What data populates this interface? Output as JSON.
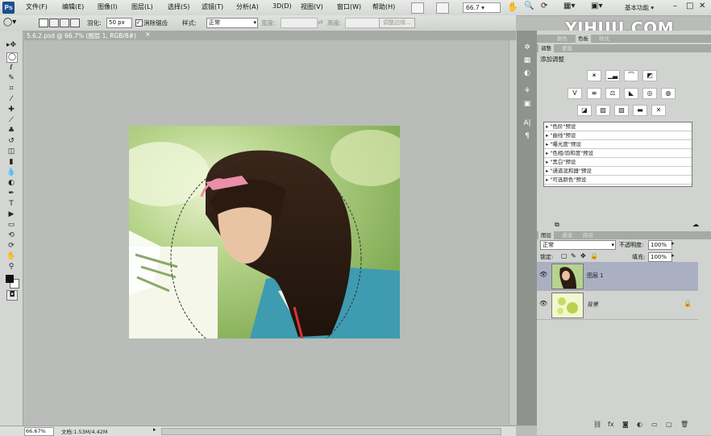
{
  "menubar": {
    "logo": "Ps",
    "items": [
      "文件(F)",
      "编辑(E)",
      "图像(I)",
      "图层(L)",
      "选择(S)",
      "滤镜(T)",
      "分析(A)",
      "3D(D)",
      "视图(V)",
      "窗口(W)",
      "帮助(H)"
    ],
    "zoom": "66.7",
    "workspace": "基本功能",
    "brand": "YIHUU.COM"
  },
  "options": {
    "feather_label": "羽化:",
    "feather_value": "50 px",
    "antialias_label": "消除锯齿",
    "style_label": "样式:",
    "style_value": "正常",
    "width_label": "宽度:",
    "height_label": "高度:",
    "refine_button": "调整边缘..."
  },
  "document": {
    "tab_title": "5.6.2.psd @ 66.7% (图层 1, RGB/8#)"
  },
  "status": {
    "zoom": "66.67%",
    "doc_info": "文档:1.53M/4.42M"
  },
  "adjust_panel": {
    "tabs": [
      "调整",
      "蒙版"
    ],
    "top_tabs": [
      "颜色",
      "色板",
      "样式"
    ],
    "heading": "添加调整",
    "presets": [
      "\"色阶\"预设",
      "\"曲线\"预设",
      "\"曝光度\"预设",
      "\"色相/饱和度\"预设",
      "\"黑白\"预设",
      "\"通道混和器\"预设",
      "\"可选颜色\"预设"
    ]
  },
  "layers_panel": {
    "tabs": [
      "图层",
      "通道",
      "路径"
    ],
    "blend_mode": "正常",
    "opacity_label": "不透明度:",
    "opacity": "100%",
    "lock_label": "锁定:",
    "fill_label": "填充:",
    "fill": "100%",
    "layers": [
      {
        "name": "图层 1"
      },
      {
        "name": "背景"
      }
    ]
  },
  "colors": {
    "accent": "#1c4f8e"
  }
}
